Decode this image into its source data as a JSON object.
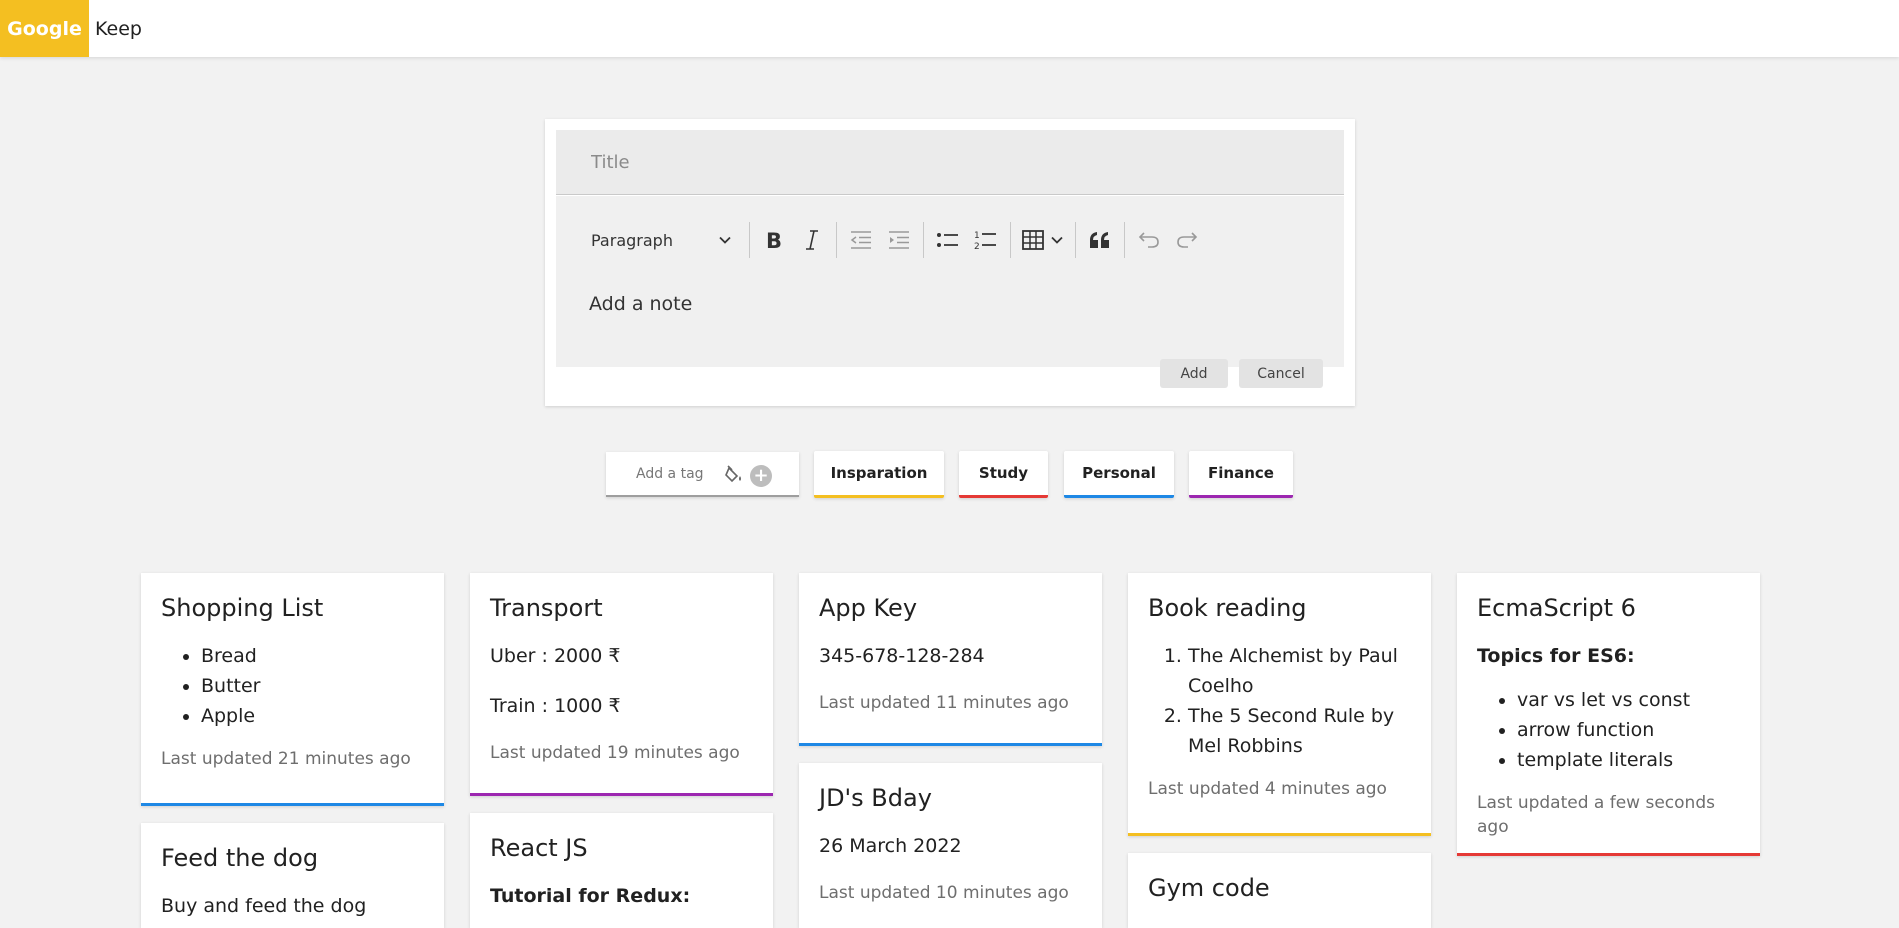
{
  "header": {
    "brand_google": "Google",
    "brand_keep": "Keep",
    "brand_color": "#f4bf21"
  },
  "editor": {
    "title_placeholder": "Title",
    "paragraph_label": "Paragraph",
    "body_placeholder": "Add a note",
    "add_label": "Add",
    "cancel_label": "Cancel"
  },
  "tags": {
    "placeholder": "Add a tag",
    "items": [
      {
        "label": "Insparation",
        "color": "#f4bf21"
      },
      {
        "label": "Study",
        "color": "#e53935"
      },
      {
        "label": "Personal",
        "color": "#1e88e5"
      },
      {
        "label": "Finance",
        "color": "#9c27b0"
      }
    ]
  },
  "notes": {
    "shopping": {
      "title": "Shopping List",
      "items": [
        "Bread",
        "Butter",
        "Apple"
      ],
      "updated": "Last updated 21 minutes ago",
      "color": "#1e88e5"
    },
    "feed": {
      "title": "Feed the dog",
      "text": "Buy and feed the dog"
    },
    "transport": {
      "title": "Transport",
      "lines": [
        "Uber : 2000 ₹",
        "Train : 1000 ₹"
      ],
      "updated": "Last updated 19 minutes ago",
      "color": "#9c27b0"
    },
    "react": {
      "title": "React JS",
      "subtitle": "Tutorial for Redux:"
    },
    "appkey": {
      "title": "App Key",
      "text": "345-678-128-284",
      "updated": "Last updated 11 minutes ago",
      "color": "#1e88e5"
    },
    "bday": {
      "title": "JD's Bday",
      "text": "26 March 2022",
      "updated": "Last updated 10 minutes ago"
    },
    "book": {
      "title": "Book reading",
      "items": [
        "The Alchemist by Paul Coelho",
        "The 5 Second Rule by Mel Robbins"
      ],
      "updated": "Last updated 4 minutes ago",
      "color": "#f4bf21"
    },
    "gym": {
      "title": "Gym code"
    },
    "es6": {
      "title": "EcmaScript 6",
      "subtitle": "Topics for ES6:",
      "items": [
        "var vs let vs const",
        "arrow function",
        "template literals"
      ],
      "updated": "Last updated a few seconds ago",
      "color": "#e53935"
    }
  }
}
